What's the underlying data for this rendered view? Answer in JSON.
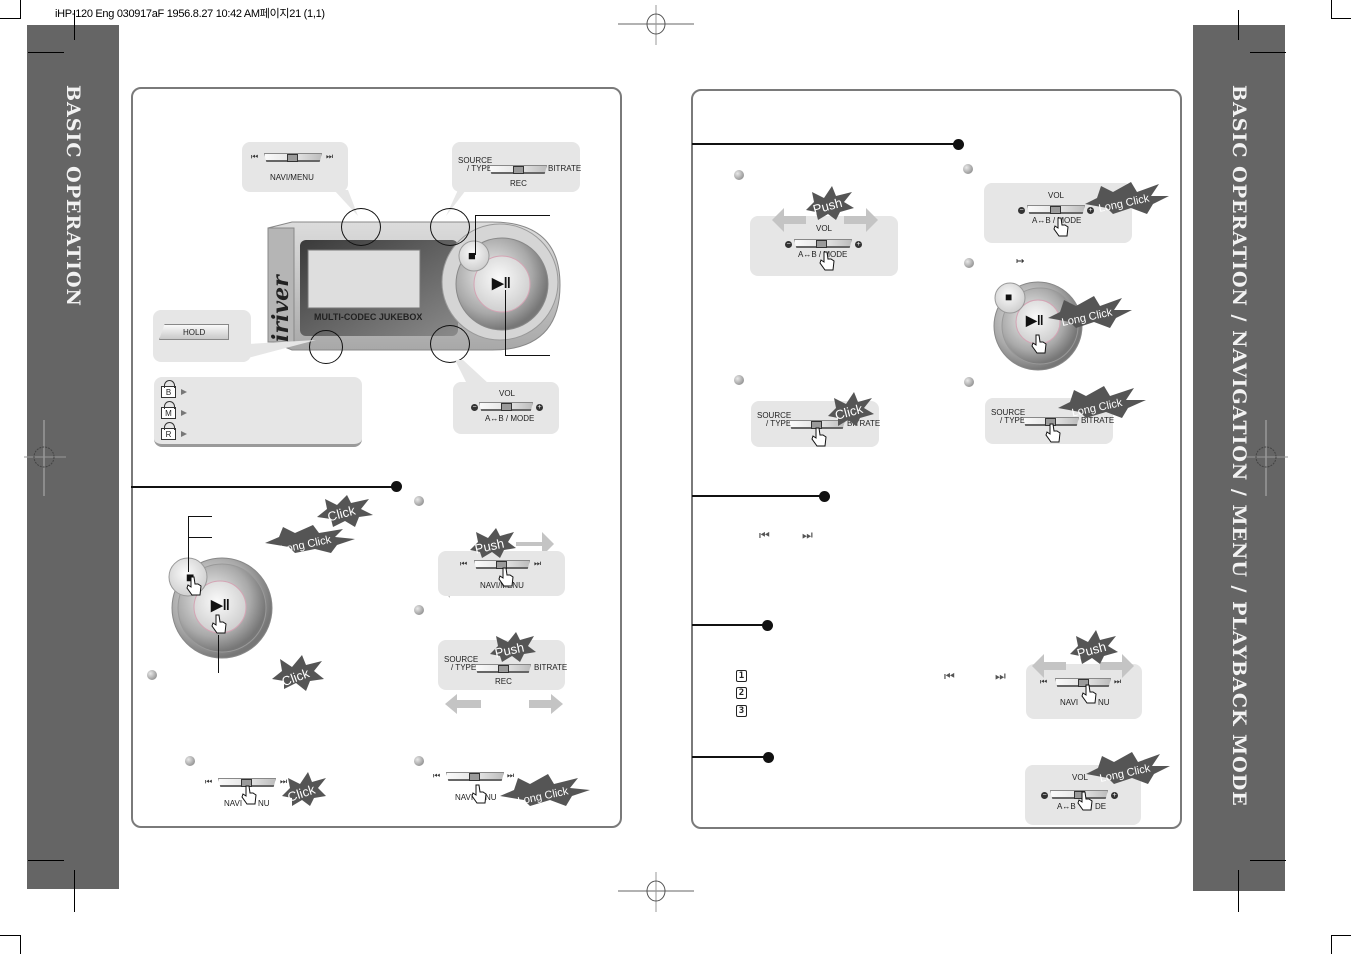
{
  "slug": "iHP-120 Eng 030917aF  1956.8.27 10:42 AM페이지21 (1,1)",
  "side_tabs": {
    "left": "BASIC OPERATION",
    "right": "BASIC OPERATION / NAVIGATION / MENU / PLAYBACK MODE"
  },
  "device": {
    "brand": "iriver",
    "caption": "MULTI-CODEC JUKEBOX",
    "navi_callout": {
      "label": "NAVI/MENU",
      "prev_icon": "⏮",
      "next_icon": "⏭"
    },
    "rec_callout": {
      "left": "SOURCE",
      "left2": "/ TYPE",
      "right": "BITRATE",
      "label": "REC"
    },
    "hold_callout": {
      "label": "HOLD"
    },
    "vol_callout": {
      "top": "VOL",
      "label": "A↔B / MODE",
      "minus": "−",
      "plus": "+"
    },
    "stop_icon": "■",
    "play_icon": "▶‖"
  },
  "hold_modes": [
    {
      "letter": "B"
    },
    {
      "letter": "M"
    },
    {
      "letter": "R"
    }
  ],
  "left_section": {
    "bursts": {
      "click_top": "Click",
      "long_click": "Long Click",
      "click_bottom": "Click"
    },
    "push_navi": {
      "burst": "Push",
      "label": "NAVI/MENU"
    },
    "push_rec": {
      "burst": "Push",
      "left": "SOURCE",
      "left2": "/ TYPE",
      "right": "BITRATE",
      "label": "REC"
    },
    "click_navi": {
      "burst": "Click",
      "label_left": "NAVI",
      "label_right": "NU"
    },
    "long_navi": {
      "burst": "Long Click",
      "label_left": "NAVI",
      "label_right": "NU"
    }
  },
  "right_section": {
    "push_vol": {
      "burst": "Push",
      "top": "VOL",
      "label": "A↔B / MODE"
    },
    "long_vol": {
      "burst": "Long Click",
      "top": "VOL",
      "label": "A↔B / MODE"
    },
    "ab_symbol": "↦",
    "long_play": {
      "burst": "Long Click"
    },
    "click_rec": {
      "burst": "Click",
      "left": "SOURCE",
      "left2": "/ TYPE",
      "right": "BITRATE"
    },
    "long_rec": {
      "burst": "Long Click",
      "left": "SOURCE",
      "left2": "/ TYPE",
      "right": "BITRATE"
    },
    "skip_icons": {
      "prev": "⏮",
      "next": "⏭"
    },
    "numbered": [
      "1",
      "2",
      "3"
    ],
    "push_navi": {
      "burst": "Push",
      "label_left": "NAVI",
      "label_right": "NU"
    },
    "long_vol2": {
      "burst": "Long Click",
      "top": "VOL",
      "label_left": "A↔B",
      "label_right": "DE"
    }
  }
}
